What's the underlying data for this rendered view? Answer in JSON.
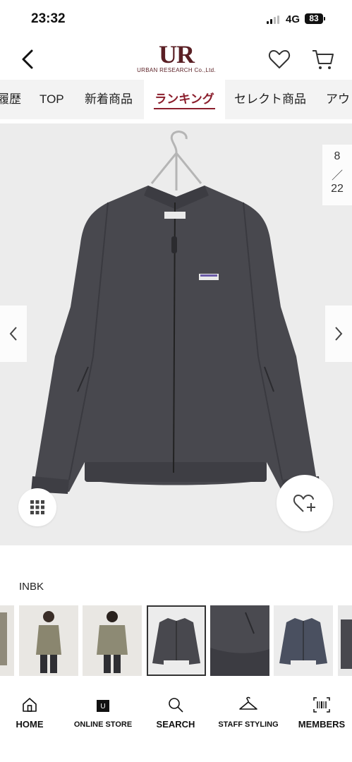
{
  "status_bar": {
    "time": "23:32",
    "network": "4G",
    "battery": "83"
  },
  "header": {
    "logo_mark": "UR",
    "logo_text": "URBAN RESEARCH Co.,Ltd.",
    "icons": [
      "chevron-left-icon",
      "heart-icon",
      "cart-icon"
    ]
  },
  "tabs": [
    {
      "label": "履歴",
      "active": false
    },
    {
      "label": "TOP",
      "active": false
    },
    {
      "label": "新着商品",
      "active": false
    },
    {
      "label": "ランキング",
      "active": true
    },
    {
      "label": "セレクト商品",
      "active": false
    },
    {
      "label": "アウ",
      "active": false
    }
  ],
  "gallery": {
    "current": "8",
    "separator": "／",
    "total": "22"
  },
  "product": {
    "color_code": "INBK"
  },
  "thumbnails": [
    {
      "desc": "partial-coat-edge"
    },
    {
      "desc": "model-front-khaki"
    },
    {
      "desc": "model-back-khaki"
    },
    {
      "desc": "jacket-black-front",
      "selected": true
    },
    {
      "desc": "jacket-black-detail"
    },
    {
      "desc": "jacket-navy-front"
    },
    {
      "desc": "partial-edge"
    }
  ],
  "bottom_nav": [
    {
      "label": "HOME",
      "icon": "home-icon"
    },
    {
      "label": "ONLINE STORE",
      "icon": "shopping-bag-icon"
    },
    {
      "label": "SEARCH",
      "icon": "search-icon"
    },
    {
      "label": "STAFF STYLING",
      "icon": "hanger-icon"
    },
    {
      "label": "MEMBERS",
      "icon": "barcode-icon"
    }
  ],
  "colors": {
    "accent": "#8b1e2c",
    "logo": "#5a1f24",
    "tab_bg": "#f3f3f3",
    "image_bg": "#ececec"
  }
}
